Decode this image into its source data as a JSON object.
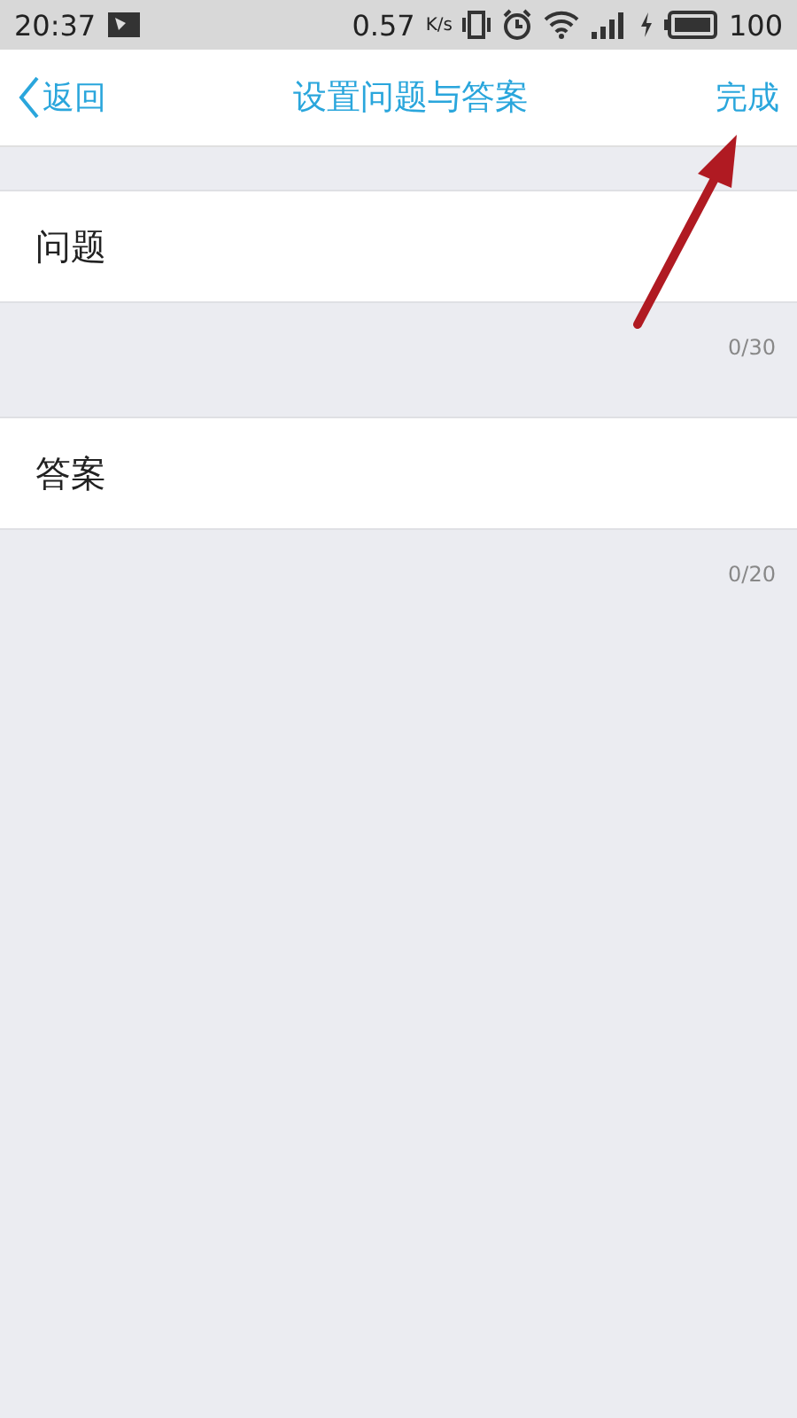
{
  "status_bar": {
    "time": "20:37",
    "speed": "0.57",
    "speed_unit": "K/s",
    "battery": "100"
  },
  "nav": {
    "back": "返回",
    "title": "设置问题与答案",
    "done": "完成"
  },
  "fields": [
    {
      "placeholder": "问题",
      "counter": "0/30"
    },
    {
      "placeholder": "答案",
      "counter": "0/20"
    }
  ]
}
